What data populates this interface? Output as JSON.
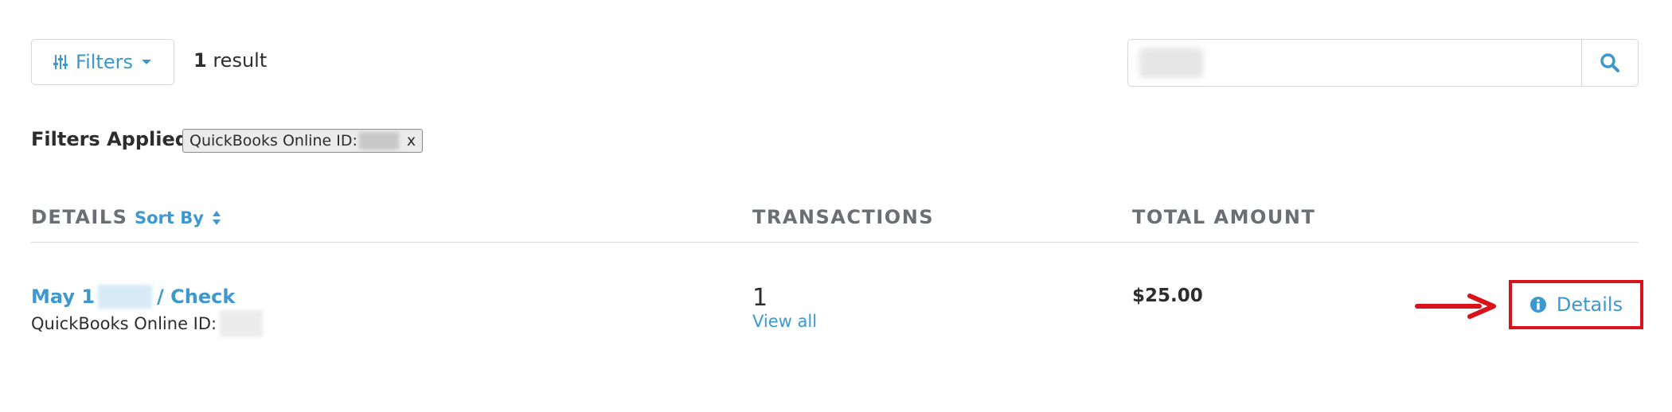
{
  "toolbar": {
    "filters_label": "Filters",
    "result_count_number": "1",
    "result_count_text": "result",
    "search": {
      "value": "",
      "placeholder": ""
    }
  },
  "filters_applied": {
    "label": "Filters Applied:",
    "chips": [
      {
        "label": "QuickBooks Online ID:",
        "remove_label": "x"
      }
    ]
  },
  "table": {
    "columns": {
      "details": "DETAILS",
      "sort_by": "Sort By",
      "transactions": "TRANSACTIONS",
      "total_amount": "TOTAL AMOUNT"
    },
    "rows": [
      {
        "title_prefix": "May 1",
        "title_suffix": "/ Check",
        "subtitle_label": "QuickBooks Online ID:",
        "transactions_count": "1",
        "view_all_label": "View all",
        "total_amount": "$25.00",
        "details_button_label": "Details"
      }
    ]
  },
  "colors": {
    "accent": "#3d98cf",
    "highlight_box": "#d9121b",
    "arrow": "#d9121b",
    "text": "#2d2d2d",
    "muted_header": "#6b6f74",
    "border": "#d6d6d6"
  },
  "icons": {
    "filters": "sliders-icon",
    "filters_caret": "caret-down-icon",
    "search": "search-icon",
    "sort": "sort-icon",
    "details": "info-circle-icon",
    "annotation_arrow": "right-arrow-icon"
  }
}
